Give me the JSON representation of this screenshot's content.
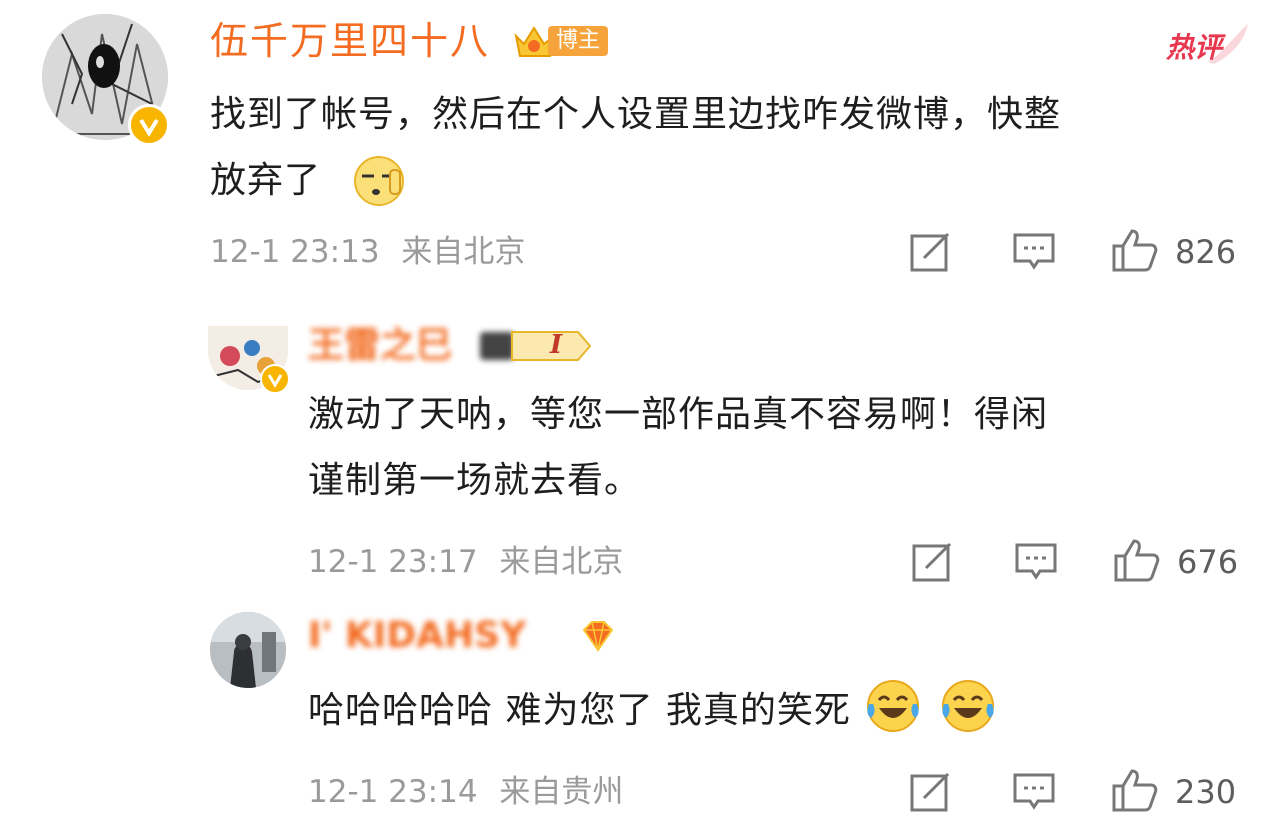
{
  "hot_label": "热评",
  "comments": [
    {
      "username": "伍千万里四十八",
      "badge": "博主",
      "text_line1": "找到了帐号，然后在个人设置里边找咋发微博，快整",
      "text_line2": "放弃了",
      "emoji": "doge-hand-emoji",
      "time": "12-1 23:13",
      "location": "来自北京",
      "likes": "826"
    },
    {
      "username": "王雷之巳",
      "level": "I",
      "text_line1": "激动了天呐，等您一部作品真不容易啊！得闲",
      "text_line2": "谨制第一场就去看。",
      "time": "12-1 23:17",
      "location": "来自北京",
      "likes": "676"
    },
    {
      "username": "I' KIDAHSY",
      "text_line1": "哈哈哈哈哈 难为您了 我真的笑死",
      "emoji": "laugh-cry-emoji",
      "time": "12-1 23:14",
      "location": "来自贵州",
      "likes": "230"
    }
  ],
  "colors": {
    "name": "#f36c21",
    "text": "#1e1e1e",
    "meta": "#9a9a9a",
    "verified": "#f7b500",
    "hot": "#e8384f"
  }
}
